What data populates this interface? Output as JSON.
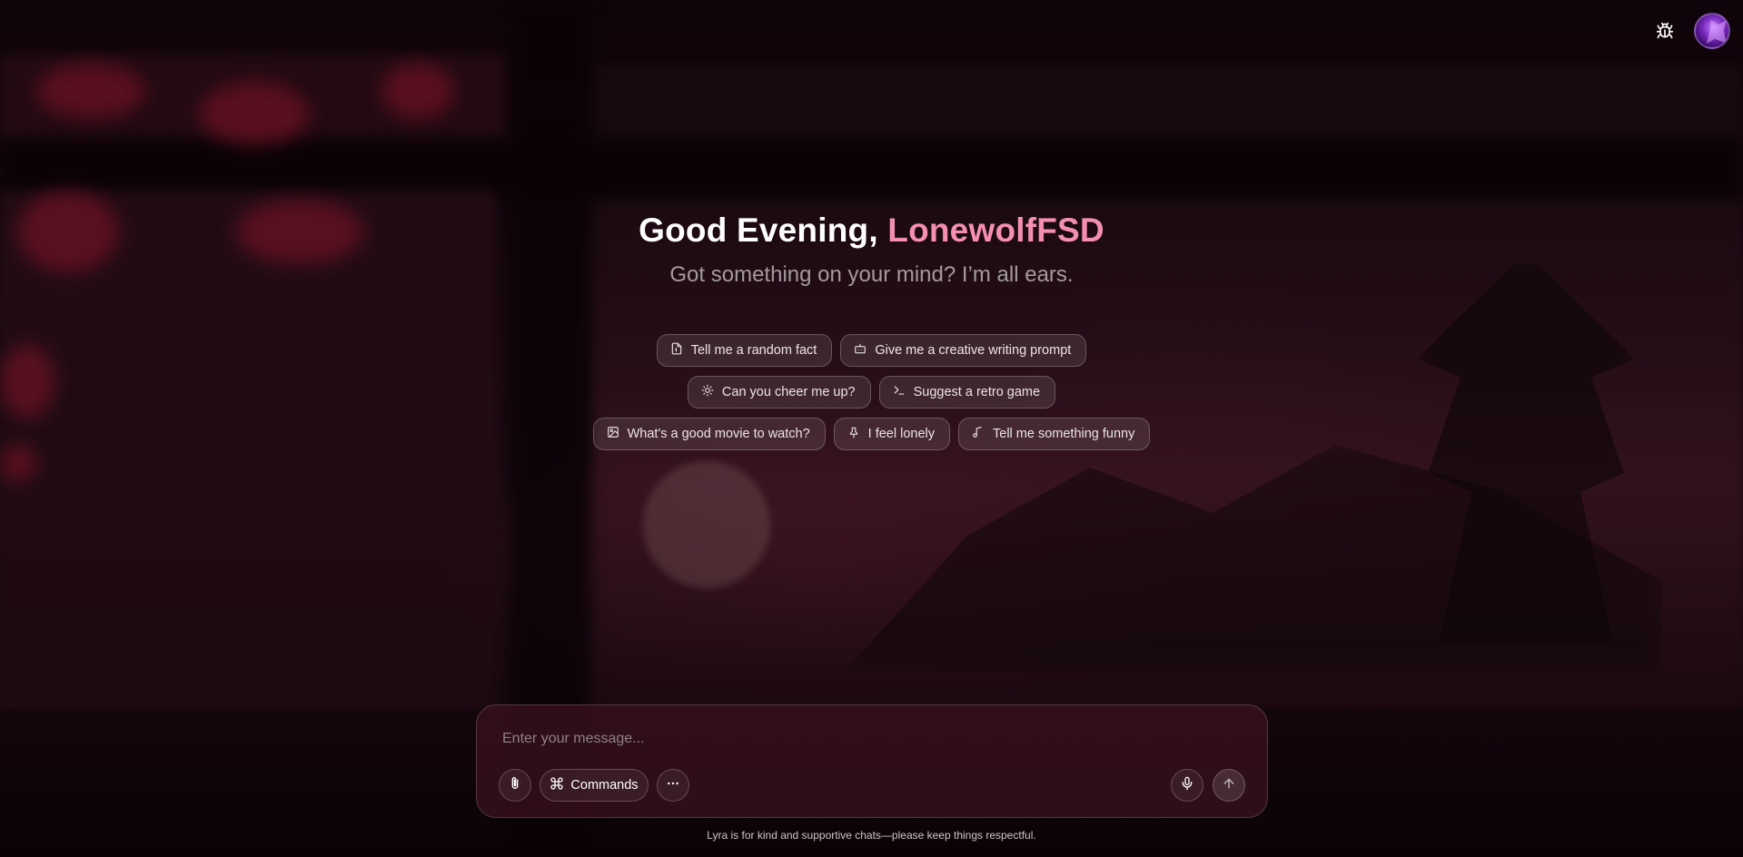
{
  "header": {
    "debug_icon": "bug-icon",
    "avatar_icon": "avatar-image"
  },
  "hero": {
    "greeting_prefix": "Good Evening, ",
    "username": "LonewolfFSD",
    "subtitle": "Got something on your mind? I’m all ears."
  },
  "suggestions": {
    "row1": [
      {
        "label": "Tell me a random fact",
        "icon": "file-icon"
      },
      {
        "label": "Give me a creative writing prompt",
        "icon": "robot-icon"
      }
    ],
    "row2": [
      {
        "label": "Can you cheer me up?",
        "icon": "sun-icon"
      },
      {
        "label": "Suggest a retro game",
        "icon": "terminal-icon"
      }
    ],
    "row3": [
      {
        "label": "What's a good movie to watch?",
        "icon": "image-icon"
      },
      {
        "label": "I feel lonely",
        "icon": "pin-icon"
      },
      {
        "label": "Tell me something funny",
        "icon": "music-icon"
      }
    ]
  },
  "composer": {
    "placeholder": "Enter your message...",
    "value": "",
    "commands_label": "Commands",
    "attach_icon": "paperclip-icon",
    "commands_icon": "command-icon",
    "more_icon": "more-icon",
    "mic_icon": "mic-icon",
    "send_icon": "arrow-up-icon"
  },
  "footer": {
    "disclaimer": "Lyra is for kind and supportive chats—please keep things respectful."
  },
  "colors": {
    "accent_name": "#f48fb1",
    "subtitle": "#a49aa0",
    "background": "#14070d"
  }
}
